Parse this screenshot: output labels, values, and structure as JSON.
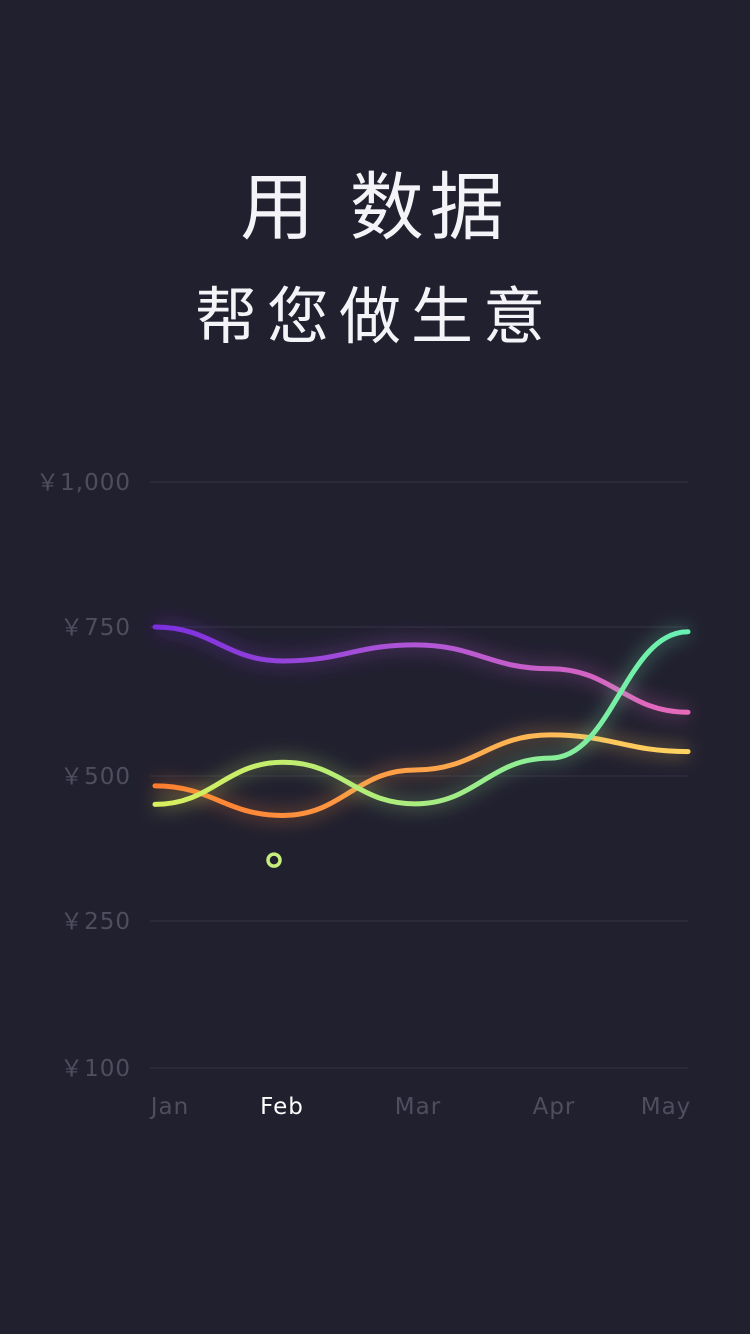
{
  "headline": {
    "line1": "用 数据",
    "line2": "帮您做生意"
  },
  "colors": {
    "background": "#21202f",
    "grid": "#343345",
    "tick_text": "#4f4e5f",
    "active_tick_text": "#ffffff"
  },
  "chart_data": {
    "type": "line",
    "title": "",
    "xlabel": "",
    "ylabel": "",
    "categories": [
      "Jan",
      "Feb",
      "Mar",
      "Apr",
      "May"
    ],
    "active_category": "Feb",
    "y_ticks": [
      {
        "value": 1000,
        "label": "￥1,000"
      },
      {
        "value": 750,
        "label": "￥750"
      },
      {
        "value": 500,
        "label": "￥500"
      },
      {
        "value": 250,
        "label": "￥250"
      },
      {
        "value": 100,
        "label": "￥100"
      }
    ],
    "grid": true,
    "series": [
      {
        "values": [
          750,
          693,
          720,
          680,
          607
        ],
        "gradient": [
          "#7b2fe0",
          "#b157d6",
          "#e86bb9"
        ]
      },
      {
        "values": [
          483,
          432,
          510,
          569,
          541
        ],
        "gradient": [
          "#ff7a2e",
          "#ffa34a",
          "#ffd462"
        ]
      },
      {
        "values": [
          451,
          523,
          452,
          530,
          742
        ],
        "gradient": [
          "#d8ef5e",
          "#a9ec80",
          "#66f0b4"
        ]
      }
    ],
    "highlight_point": {
      "category": "Feb",
      "value": 355,
      "color": "#c5ee7c"
    }
  }
}
